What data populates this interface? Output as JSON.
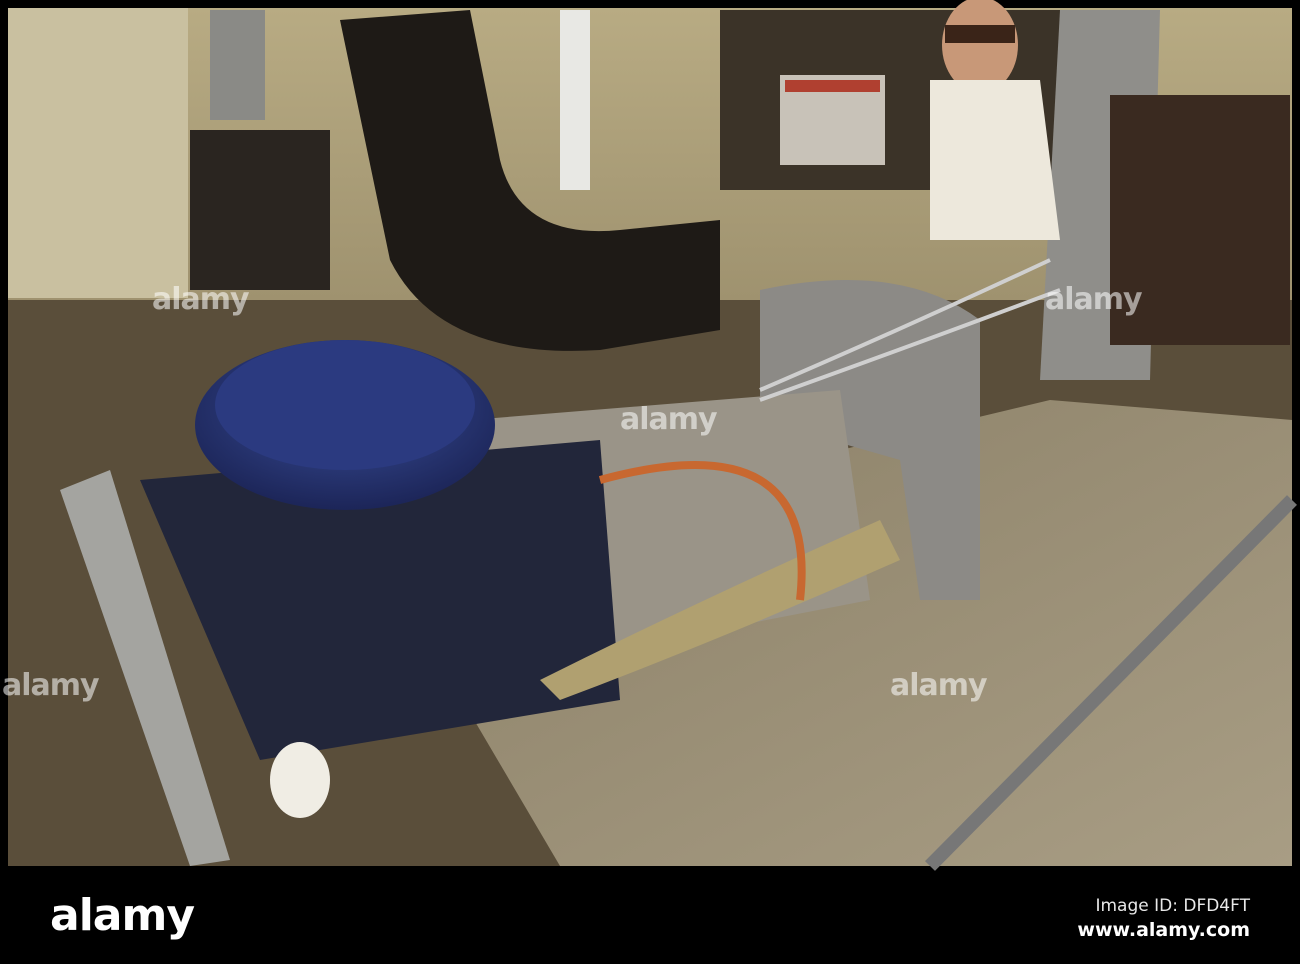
{
  "watermark": {
    "text": "alamy"
  },
  "footer": {
    "logo": "alamy",
    "image_id": "Image ID: DFD4FT",
    "url": "www.alamy.com"
  },
  "colors": {
    "background": "#000000",
    "footer_text": "#ffffff"
  }
}
